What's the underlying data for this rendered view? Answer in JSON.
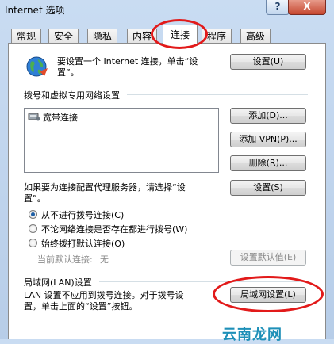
{
  "window": {
    "title": "Internet 选项",
    "help": "?",
    "close": "X"
  },
  "tabs": [
    {
      "label": "常规"
    },
    {
      "label": "安全"
    },
    {
      "label": "隐私"
    },
    {
      "label": "内容"
    },
    {
      "label": "连接",
      "active": true
    },
    {
      "label": "程序"
    },
    {
      "label": "高级"
    }
  ],
  "setup": {
    "text_line1": "要设置一个 Internet 连接，单击“设",
    "text_line2": "置”。",
    "button": "设置(U)"
  },
  "dialup": {
    "heading": "拨号和虚拟专用网络设置",
    "items": [
      "宽带连接"
    ],
    "add": "添加(D)...",
    "add_vpn": "添加 VPN(P)...",
    "delete": "删除(R)...",
    "proxy_line1": "如果要为连接配置代理服务器，请选择“设",
    "proxy_line2": "置”。",
    "settings": "设置(S)",
    "options": [
      {
        "label": "从不进行拨号连接(C)",
        "selected": true
      },
      {
        "label": "不论网络连接是否存在都进行拨号(W)",
        "selected": false
      },
      {
        "label": "始终拨打默认连接(O)",
        "selected": false
      }
    ],
    "default_label": "当前默认连接:",
    "default_value": "无",
    "set_default": "设置默认值(E)"
  },
  "lan": {
    "heading": "局域网(LAN)设置",
    "text_line1": "LAN 设置不应用到拨号连接。对于拨号设",
    "text_line2": "置，单击上面的“设置”按钮。",
    "button": "局域网设置(L)"
  },
  "watermark": "云南龙网"
}
